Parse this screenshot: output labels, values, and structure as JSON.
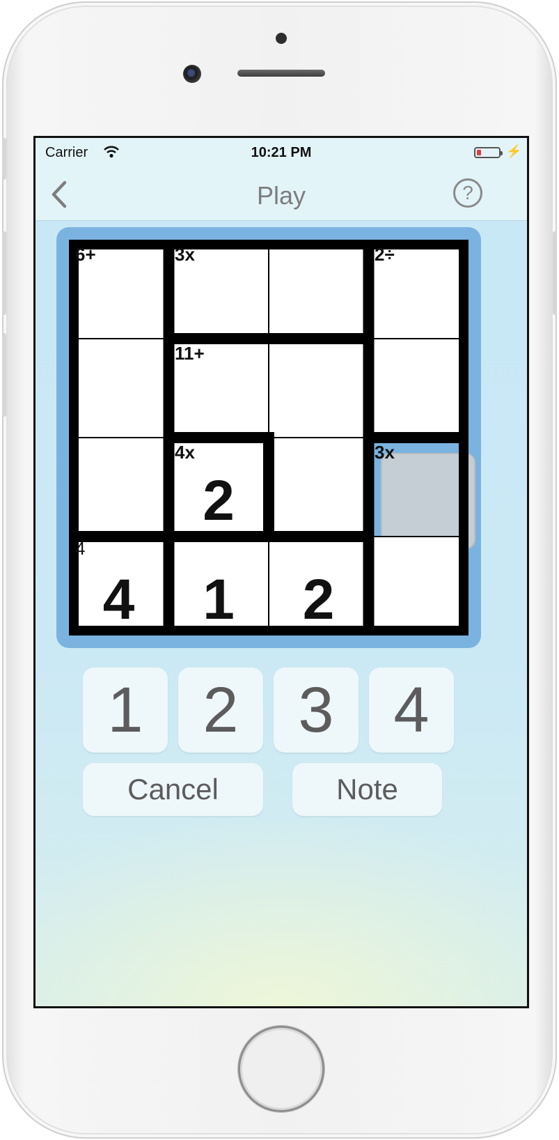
{
  "status_bar": {
    "carrier": "Carrier",
    "time": "10:21 PM",
    "battery_level": 0.2
  },
  "nav": {
    "title": "Play",
    "back_icon": "chevron-left-icon",
    "help_icon": "?"
  },
  "puzzle": {
    "size": 4,
    "cages": [
      {
        "label": "6+",
        "cells": [
          [
            0,
            0
          ],
          [
            1,
            0
          ],
          [
            2,
            0
          ]
        ]
      },
      {
        "label": "3x",
        "cells": [
          [
            0,
            1
          ],
          [
            0,
            2
          ]
        ]
      },
      {
        "label": "2÷",
        "cells": [
          [
            0,
            3
          ],
          [
            1,
            3
          ]
        ]
      },
      {
        "label": "11+",
        "cells": [
          [
            1,
            1
          ],
          [
            1,
            2
          ],
          [
            2,
            2
          ]
        ]
      },
      {
        "label": "4x",
        "cells": [
          [
            2,
            1
          ]
        ]
      },
      {
        "label": "3x",
        "cells": [
          [
            2,
            3
          ],
          [
            3,
            3
          ]
        ]
      },
      {
        "label": "4",
        "cells": [
          [
            3,
            0
          ]
        ]
      },
      {
        "label": "",
        "cells": [
          [
            3,
            1
          ],
          [
            3,
            2
          ]
        ]
      }
    ],
    "cage_labels": {
      "c00": "6+",
      "c01": "3x",
      "c03": "2÷",
      "c11": "11+",
      "c21": "4x",
      "c23": "3x",
      "c30": "4"
    },
    "values": {
      "v21": "2",
      "v30": "4",
      "v31": "1",
      "v32": "2"
    },
    "selected_cell": [
      2,
      3
    ]
  },
  "keypad": {
    "k1": "1",
    "k2": "2",
    "k3": "3",
    "k4": "4"
  },
  "actions": {
    "cancel": "Cancel",
    "note": "Note"
  }
}
